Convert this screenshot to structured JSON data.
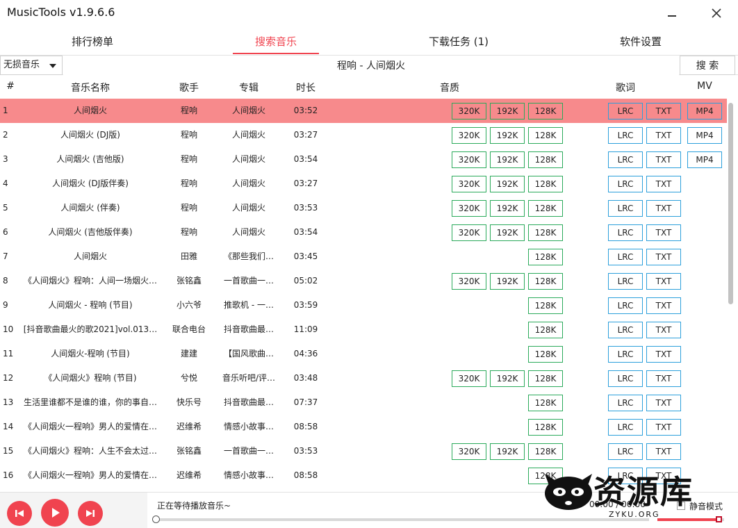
{
  "window": {
    "title": "MusicTools v1.9.6.6"
  },
  "tabs": [
    {
      "label": "排行榜单"
    },
    {
      "label": "搜索音乐"
    },
    {
      "label": "下载任务 (1)"
    },
    {
      "label": "软件设置"
    }
  ],
  "search": {
    "quality_selected": "无损音乐",
    "query": "程响 - 人间烟火",
    "button_label": "搜 索"
  },
  "table": {
    "headers": {
      "index": "#",
      "name": "音乐名称",
      "singer": "歌手",
      "album": "专辑",
      "duration": "时长",
      "quality": "音质",
      "lyrics": "歌词",
      "mv": "MV"
    },
    "rows": [
      {
        "index": "1",
        "name": "人间烟火",
        "singer": "程响",
        "album": "人间烟火",
        "duration": "03:52",
        "q320": "320K",
        "q192": "192K",
        "q128": "128K",
        "lrc": "LRC",
        "txt": "TXT",
        "mv": "MP4"
      },
      {
        "index": "2",
        "name": "人间烟火 (DJ版)",
        "singer": "程响",
        "album": "人间烟火",
        "duration": "03:27",
        "q320": "320K",
        "q192": "192K",
        "q128": "128K",
        "lrc": "LRC",
        "txt": "TXT",
        "mv": "MP4"
      },
      {
        "index": "3",
        "name": "人间烟火 (吉他版)",
        "singer": "程响",
        "album": "人间烟火",
        "duration": "03:54",
        "q320": "320K",
        "q192": "192K",
        "q128": "128K",
        "lrc": "LRC",
        "txt": "TXT",
        "mv": "MP4"
      },
      {
        "index": "4",
        "name": "人间烟火 (DJ版伴奏)",
        "singer": "程响",
        "album": "人间烟火",
        "duration": "03:27",
        "q320": "320K",
        "q192": "192K",
        "q128": "128K",
        "lrc": "LRC",
        "txt": "TXT",
        "mv": ""
      },
      {
        "index": "5",
        "name": "人间烟火 (伴奏)",
        "singer": "程响",
        "album": "人间烟火",
        "duration": "03:53",
        "q320": "320K",
        "q192": "192K",
        "q128": "128K",
        "lrc": "LRC",
        "txt": "TXT",
        "mv": ""
      },
      {
        "index": "6",
        "name": "人间烟火 (吉他版伴奏)",
        "singer": "程响",
        "album": "人间烟火",
        "duration": "03:54",
        "q320": "320K",
        "q192": "192K",
        "q128": "128K",
        "lrc": "LRC",
        "txt": "TXT",
        "mv": ""
      },
      {
        "index": "7",
        "name": "人间烟火",
        "singer": "田雅",
        "album": "《那些我们…",
        "duration": "03:45",
        "q320": "",
        "q192": "",
        "q128": "128K",
        "lrc": "LRC",
        "txt": "TXT",
        "mv": ""
      },
      {
        "index": "8",
        "name": "《人间烟火》程响：人间一场烟火…",
        "singer": "张铭鑫",
        "album": "一首歌曲一…",
        "duration": "05:02",
        "q320": "320K",
        "q192": "192K",
        "q128": "128K",
        "lrc": "LRC",
        "txt": "TXT",
        "mv": ""
      },
      {
        "index": "9",
        "name": "人间烟火 - 程响 (节目)",
        "singer": "小六爷",
        "album": "推歌机 - 一…",
        "duration": "03:59",
        "q320": "",
        "q192": "",
        "q128": "128K",
        "lrc": "LRC",
        "txt": "TXT",
        "mv": ""
      },
      {
        "index": "10",
        "name": "[抖音歌曲最火的歌2021]vol.013…",
        "singer": "联合电台",
        "album": "抖音歌曲最…",
        "duration": "11:09",
        "q320": "",
        "q192": "",
        "q128": "128K",
        "lrc": "LRC",
        "txt": "TXT",
        "mv": ""
      },
      {
        "index": "11",
        "name": "人间烟火-程响 (节目)",
        "singer": "建建",
        "album": "【国风歌曲…",
        "duration": "04:36",
        "q320": "",
        "q192": "",
        "q128": "128K",
        "lrc": "LRC",
        "txt": "TXT",
        "mv": ""
      },
      {
        "index": "12",
        "name": "《人间烟火》程响 (节目)",
        "singer": "兮悦",
        "album": "音乐听吧/评…",
        "duration": "03:48",
        "q320": "320K",
        "q192": "192K",
        "q128": "128K",
        "lrc": "LRC",
        "txt": "TXT",
        "mv": ""
      },
      {
        "index": "13",
        "name": "生活里谁都不是谁的谁，你的事自…",
        "singer": "快乐号",
        "album": "抖音歌曲最…",
        "duration": "07:37",
        "q320": "",
        "q192": "",
        "q128": "128K",
        "lrc": "LRC",
        "txt": "TXT",
        "mv": ""
      },
      {
        "index": "14",
        "name": "《人间烟火一程响》男人的爱情在…",
        "singer": "迟维希",
        "album": "情感小故事…",
        "duration": "08:58",
        "q320": "",
        "q192": "",
        "q128": "128K",
        "lrc": "LRC",
        "txt": "TXT",
        "mv": ""
      },
      {
        "index": "15",
        "name": "《人间烟火》程响：人生不会太过…",
        "singer": "张铭鑫",
        "album": "一首歌曲一…",
        "duration": "03:53",
        "q320": "320K",
        "q192": "192K",
        "q128": "128K",
        "lrc": "LRC",
        "txt": "TXT",
        "mv": ""
      },
      {
        "index": "16",
        "name": "《人间烟火一程响》男人的爱情在…",
        "singer": "迟维希",
        "album": "情感小故事…",
        "duration": "08:58",
        "q320": "",
        "q192": "",
        "q128": "128K",
        "lrc": "LRC",
        "txt": "TXT",
        "mv": ""
      }
    ]
  },
  "player": {
    "status": "正在等待播放音乐~",
    "time": "00:00 / 00:00",
    "mute_label": "静音模式",
    "progress": 0,
    "volume": 0.9
  },
  "watermark": {
    "text": "资源库",
    "sub": "ZYKU.ORG"
  },
  "colors": {
    "accent": "#f0434f",
    "selected_row": "#f78a8c",
    "quality_border": "#2aaa5a",
    "lyrics_border": "#2b9fdb"
  }
}
